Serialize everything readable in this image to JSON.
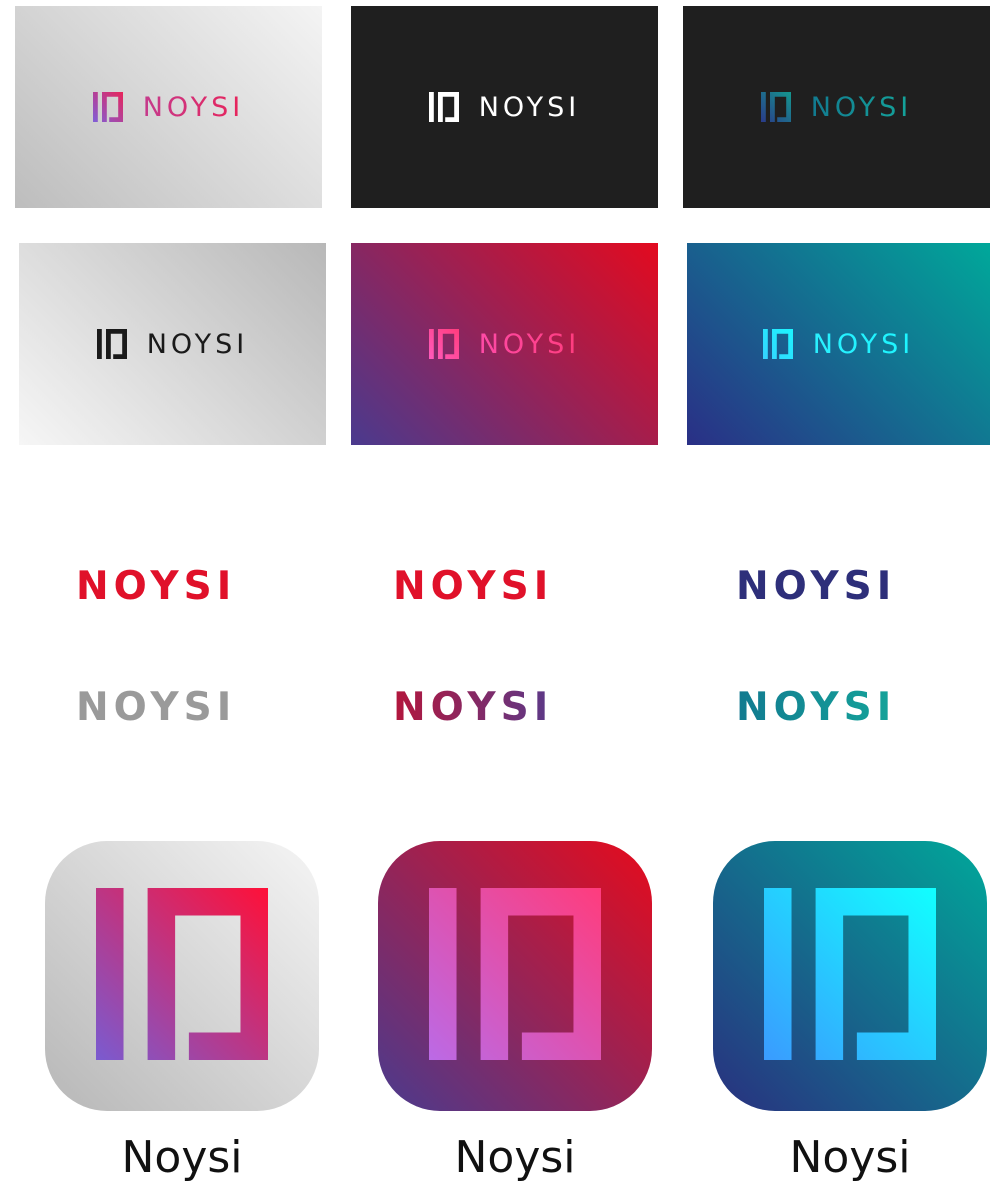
{
  "brand": {
    "wordmark": "NOYSI",
    "app_label": "Noysi"
  },
  "cards": [
    {
      "id": "card-light-gradient-1",
      "icon": "noysi-n-icon",
      "bg": [
        "#f4f4f4",
        "#bdbdbd"
      ],
      "icon_colors": [
        "#7f5fd8",
        "#e8245a"
      ],
      "text_colors": [
        "#c53a8c",
        "#e8245a"
      ]
    },
    {
      "id": "card-dark-white",
      "icon": "noysi-n-icon",
      "bg": [
        "#1f1f1f",
        "#1f1f1f"
      ],
      "icon_colors": [
        "#ffffff",
        "#ffffff"
      ],
      "text_colors": [
        "#ffffff",
        "#ffffff"
      ]
    },
    {
      "id": "card-dark-teal",
      "icon": "noysi-n-icon",
      "bg": [
        "#1f1f1f",
        "#1f1f1f"
      ],
      "icon_colors": [
        "#2a3a8a",
        "#14988f"
      ],
      "text_colors": [
        "#127a90",
        "#14a49a"
      ]
    },
    {
      "id": "card-light-gradient-2",
      "icon": "noysi-n-icon",
      "bg": [
        "#b8b8b8",
        "#f6f6f6"
      ],
      "icon_colors": [
        "#1a1a1a",
        "#1a1a1a"
      ],
      "text_colors": [
        "#1a1a1a",
        "#1a1a1a"
      ]
    },
    {
      "id": "card-magenta",
      "icon": "noysi-n-icon",
      "bg": [
        "#e30a1f",
        "#4a3a8e"
      ],
      "icon_colors": [
        "#ff5bbd",
        "#ff3c7d"
      ],
      "text_colors": [
        "#ff4aa7",
        "#ff3c7d"
      ]
    },
    {
      "id": "card-teal",
      "icon": "noysi-n-icon",
      "bg": [
        "#00a89a",
        "#2a2f86"
      ],
      "icon_colors": [
        "#35d3ff",
        "#1cf5ff"
      ],
      "text_colors": [
        "#2af0ff",
        "#1cf5ff"
      ]
    }
  ],
  "free_logos": [
    {
      "id": "logo-red",
      "icon": "noysi-n-icon",
      "icon_colors": [
        "#e0112a",
        "#e0112a"
      ],
      "text_colors": [
        "#e0112a",
        "#e0112a"
      ]
    },
    {
      "id": "logo-indigo-red",
      "icon": "noysi-n-icon",
      "icon_colors": [
        "#3c3e8f",
        "#3c3e8f"
      ],
      "text_colors": [
        "#e0112a",
        "#e0112a"
      ]
    },
    {
      "id": "logo-teal-navy",
      "icon": "noysi-n-icon",
      "icon_colors": [
        "#14958c",
        "#14958c"
      ],
      "text_colors": [
        "#2e2f7a",
        "#2e2f7a"
      ]
    },
    {
      "id": "logo-gray",
      "icon": "noysi-n-icon",
      "icon_colors": [
        "#9a9a9a",
        "#9a9a9a"
      ],
      "text_colors": [
        "#9a9a9a",
        "#9a9a9a"
      ]
    },
    {
      "id": "logo-red-purple",
      "icon": "noysi-n-icon",
      "icon_colors": [
        "#e0112a",
        "#e0112a"
      ],
      "text_colors": [
        "#b3163c",
        "#5a3a8a"
      ]
    },
    {
      "id": "logo-navy-teal",
      "icon": "noysi-n-icon",
      "icon_colors": [
        "#2a3a8a",
        "#2a3a8a"
      ],
      "text_colors": [
        "#127a90",
        "#14a49a"
      ]
    }
  ],
  "app_icons": [
    {
      "id": "app-light",
      "icon": "noysi-n-icon",
      "bg": [
        "#f5f5f5",
        "#b7b7b7"
      ],
      "icon_colors": [
        "#7a5bd0",
        "#ff1038"
      ]
    },
    {
      "id": "app-magenta",
      "icon": "noysi-n-icon",
      "bg": [
        "#e60b1c",
        "#4a3b8e"
      ],
      "icon_colors": [
        "#bb6ae6",
        "#ff3c7d"
      ]
    },
    {
      "id": "app-teal",
      "icon": "noysi-n-icon",
      "bg": [
        "#00a89a",
        "#29307f"
      ],
      "icon_colors": [
        "#3a9bff",
        "#11ffff"
      ]
    }
  ]
}
